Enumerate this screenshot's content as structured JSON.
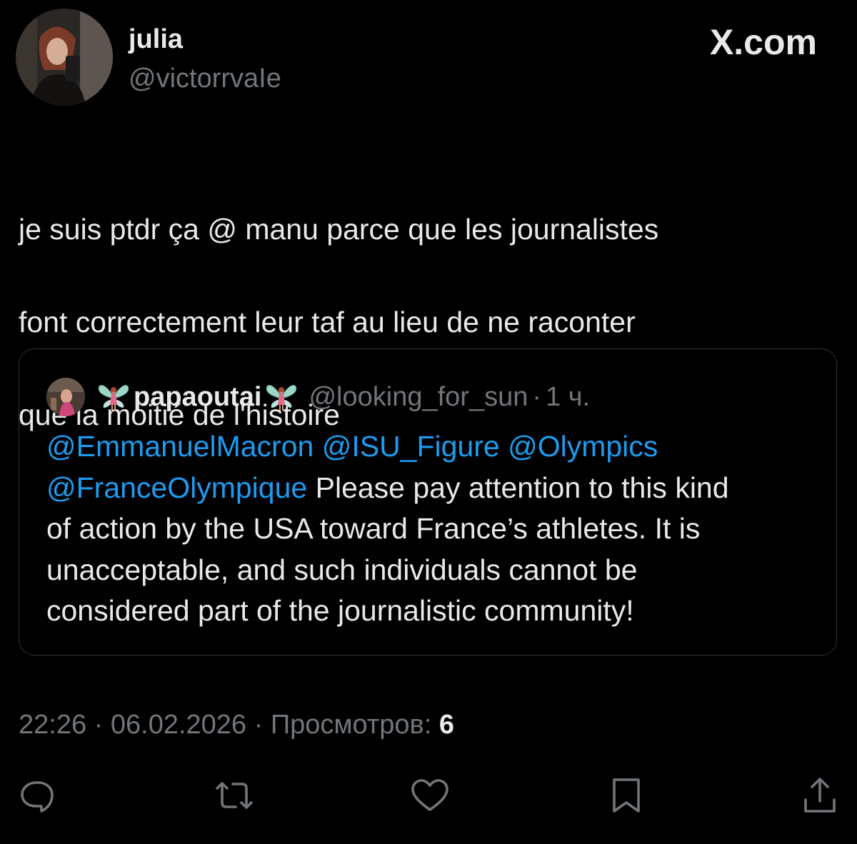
{
  "author": {
    "name": "julia",
    "handle": "@victorrvaIe"
  },
  "brand": "X.com",
  "tweet": {
    "text_lines": [
      "je suis ptdr ça @ manu parce que les journalistes",
      "font correctement leur taf au lieu de ne raconter",
      "que la moitié de l'histoire"
    ]
  },
  "quote": {
    "name": "papaoutai",
    "decoration_icon": "butterfly-fairy-icon",
    "handle": "@looking_for_sun",
    "separator": "·",
    "time": "1 ч.",
    "mentions": [
      "@EmmanuelMacron",
      "@ISU_Figure",
      "@Olympics",
      "@FranceOlympique"
    ],
    "body_lines": [
      "Please pay attention to this kind",
      "of action by the USA toward France’s athletes. It is",
      "unacceptable, and such individuals cannot be",
      "considered part of the journalistic community!"
    ]
  },
  "meta": {
    "time": "22:26",
    "separator": "·",
    "date": "06.02.2026",
    "views_label": "Просмотров:",
    "views_count": "6"
  },
  "actions": [
    "reply-icon",
    "retweet-icon",
    "like-icon",
    "bookmark-icon",
    "share-icon"
  ],
  "colors": {
    "background": "#000000",
    "text": "#e7e9ea",
    "secondary": "#71767b",
    "link": "#1d9bf0",
    "border": "#2f3336"
  }
}
